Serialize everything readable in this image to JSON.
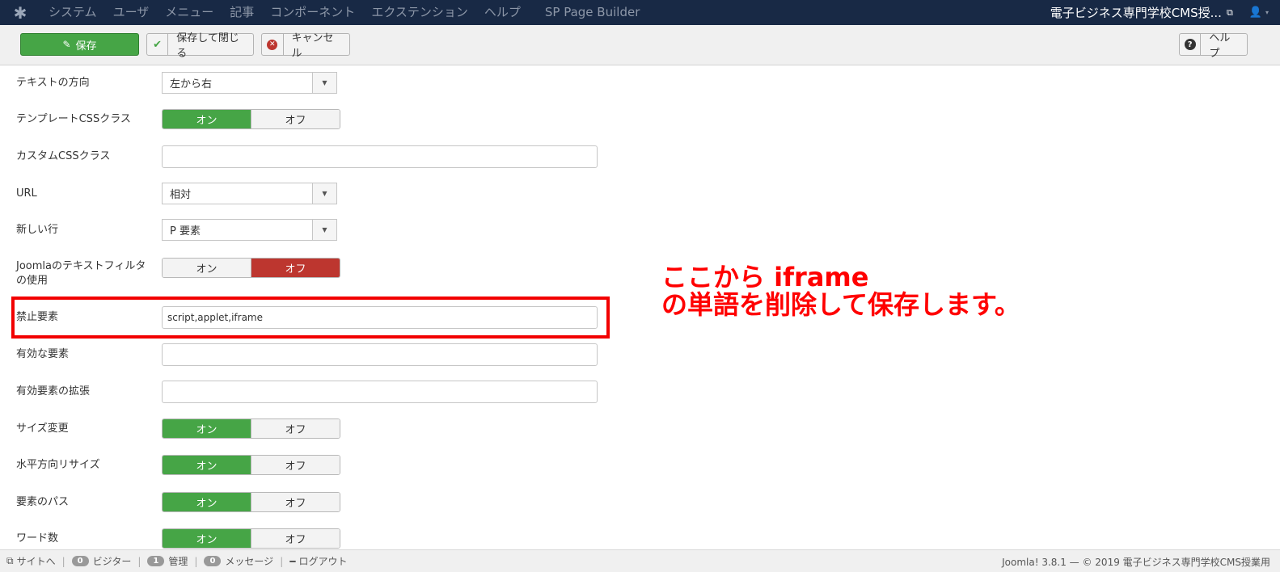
{
  "navbar": {
    "menu": [
      "システム",
      "ユーザ",
      "メニュー",
      "記事",
      "コンポーネント",
      "エクステンション",
      "ヘルプ"
    ],
    "extra_menu": "SP Page Builder",
    "site_title": "電子ビジネス専門学校CMS授...",
    "bg_color": "#182945"
  },
  "toolbar": {
    "save": "保存",
    "save_close": "保存して閉じる",
    "cancel": "キャンセル",
    "help": "ヘルプ"
  },
  "form": {
    "text_direction": {
      "label": "テキストの方向",
      "value": "左から右"
    },
    "template_css": {
      "label": "テンプレートCSSクラス",
      "on": "オン",
      "off": "オフ",
      "selected": "on"
    },
    "custom_css": {
      "label": "カスタムCSSクラス",
      "value": ""
    },
    "url": {
      "label": "URL",
      "value": "相対"
    },
    "new_line": {
      "label": "新しい行",
      "value": "P 要素"
    },
    "text_filter": {
      "label": "Joomlaのテキストフィルタの使用",
      "on": "オン",
      "off": "オフ",
      "selected": "off"
    },
    "prohibited": {
      "label": "禁止要素",
      "value": "script,applet,iframe"
    },
    "valid_elements": {
      "label": "有効な要素",
      "value": ""
    },
    "extended_elements": {
      "label": "有効要素の拡張",
      "value": ""
    },
    "resize": {
      "label": "サイズ変更",
      "on": "オン",
      "off": "オフ",
      "selected": "on"
    },
    "horizontal_resize": {
      "label": "水平方向リサイズ",
      "on": "オン",
      "off": "オフ",
      "selected": "on"
    },
    "element_path": {
      "label": "要素のパス",
      "on": "オン",
      "off": "オフ",
      "selected": "on"
    },
    "word_count": {
      "label": "ワード数",
      "on": "オン",
      "off": "オフ",
      "selected": "on"
    }
  },
  "annotation": {
    "line1": "ここから iframe",
    "line2": "の単語を削除して保存します。",
    "color": "#ff0000"
  },
  "statusbar": {
    "site": "サイトへ",
    "visitors_count": "0",
    "visitors": "ビジター",
    "admin_count": "1",
    "admin": "管理",
    "messages_count": "0",
    "messages": "メッセージ",
    "logout": "ログアウト",
    "footer": "Joomla! 3.8.1 — © 2019 電子ビジネス専門学校CMS授業用"
  }
}
